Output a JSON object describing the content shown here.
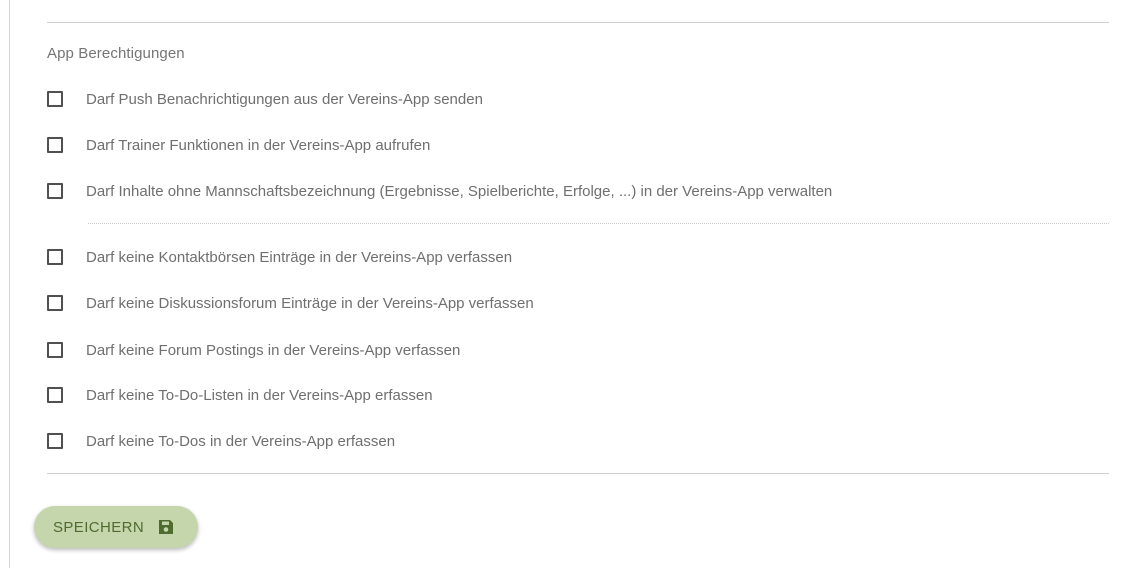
{
  "section": {
    "title": "App Berechtigungen"
  },
  "permissions": [
    {
      "label": "Darf Push Benachrichtigungen aus der Vereins-App senden",
      "checked": false
    },
    {
      "label": "Darf Trainer Funktionen in der Vereins-App aufrufen",
      "checked": false
    },
    {
      "label": "Darf Inhalte ohne Mannschaftsbezeichnung (Ergebnisse, Spielberichte, Erfolge, ...) in der Vereins-App verwalten",
      "checked": false
    }
  ],
  "restrictions": [
    {
      "label": "Darf keine Kontaktbörsen Einträge in der Vereins-App verfassen",
      "checked": false
    },
    {
      "label": "Darf keine Diskussionsforum Einträge in der Vereins-App verfassen",
      "checked": false
    },
    {
      "label": "Darf keine Forum Postings in der Vereins-App verfassen",
      "checked": false
    },
    {
      "label": "Darf keine To-Do-Listen in der Vereins-App erfassen",
      "checked": false
    },
    {
      "label": "Darf keine To-Dos in der Vereins-App erfassen",
      "checked": false
    }
  ],
  "actions": {
    "save_label": "SPEICHERN",
    "save_icon": "floppy-disk-icon"
  },
  "colors": {
    "save_button_bg": "#c5d6ad",
    "save_button_text": "#4f6b2f"
  }
}
